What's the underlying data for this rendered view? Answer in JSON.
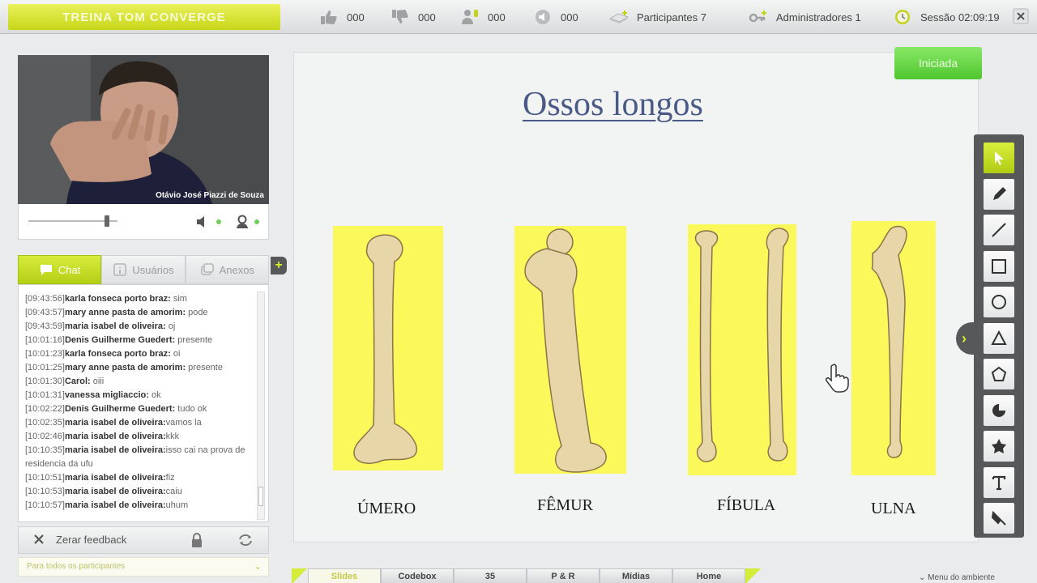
{
  "app": {
    "brand": "TREINA TOM CONVERGE"
  },
  "stats": {
    "likes": "000",
    "dislikes": "000",
    "hands": "000",
    "audio": "000",
    "participants": "Participantes 7",
    "admins": "Administradores 1",
    "session": "Sessão 02:09:19"
  },
  "video": {
    "caption": "Otávio José Piazzi de Souza"
  },
  "tabs": {
    "chat": "Chat",
    "users": "Usuários",
    "attachments": "Anexos"
  },
  "chat": {
    "messages": [
      {
        "time": "[09:43:56]",
        "name": "karla fonseca porto braz:",
        "text": " sim"
      },
      {
        "time": "[09:43:57]",
        "name": "mary anne pasta de amorim:",
        "text": " pode"
      },
      {
        "time": "[09:43:59]",
        "name": "maria isabel de oliveira:",
        "text": " oj"
      },
      {
        "time": "[10:01:16]",
        "name": "Denis Guilherme Guedert:",
        "text": " presente"
      },
      {
        "time": "[10:01:23]",
        "name": "karla fonseca porto braz:",
        "text": " oi"
      },
      {
        "time": "[10:01:25]",
        "name": "mary anne pasta de amorim:",
        "text": " presente"
      },
      {
        "time": "[10:01:30]",
        "name": "Carol:",
        "text": " oiii"
      },
      {
        "time": "[10:01:31]",
        "name": "vanessa migliaccio:",
        "text": " ok"
      },
      {
        "time": "[10:02:22]",
        "name": "Denis Guilherme Guedert:",
        "text": " tudo ok"
      },
      {
        "time": "[10:02:35]",
        "name": "maria isabel de oliveira:",
        "text": "vamos la"
      },
      {
        "time": "[10:02:46]",
        "name": "maria isabel de oliveira:",
        "text": "kkk"
      },
      {
        "time": "[10:10:35]",
        "name": "maria isabel de oliveira:",
        "text": "isso cai na prova de residencia da ufu"
      },
      {
        "time": "[10:10:51]",
        "name": "maria isabel de oliveira:",
        "text": "fiz"
      },
      {
        "time": "[10:10:53]",
        "name": "maria isabel de oliveira:",
        "text": "caiu"
      },
      {
        "time": "[10:10:57]",
        "name": "maria isabel de oliveira:",
        "text": "uhum"
      }
    ]
  },
  "feedback": {
    "reset": "Zerar feedback",
    "audience": "Para todos os participantes"
  },
  "slide": {
    "title": "Ossos longos",
    "bones": [
      "ÚMERO",
      "FÊMUR",
      "FÍBULA",
      "ULNA"
    ]
  },
  "status": {
    "started": "Iniciada"
  },
  "tools": [
    "select",
    "pencil",
    "line",
    "rectangle",
    "circle",
    "triangle",
    "pentagon",
    "pie",
    "star",
    "text",
    "eraser"
  ],
  "bottom_tabs": [
    "Slides",
    "Codebox",
    "35",
    "P & R",
    "Mídias",
    "Home"
  ],
  "env_menu": "Menu do ambiente",
  "colors": {
    "accent": "#c7d61a",
    "started": "#4fc62f",
    "slide_bg": "#fbf85b",
    "title": "#4a5a86"
  }
}
